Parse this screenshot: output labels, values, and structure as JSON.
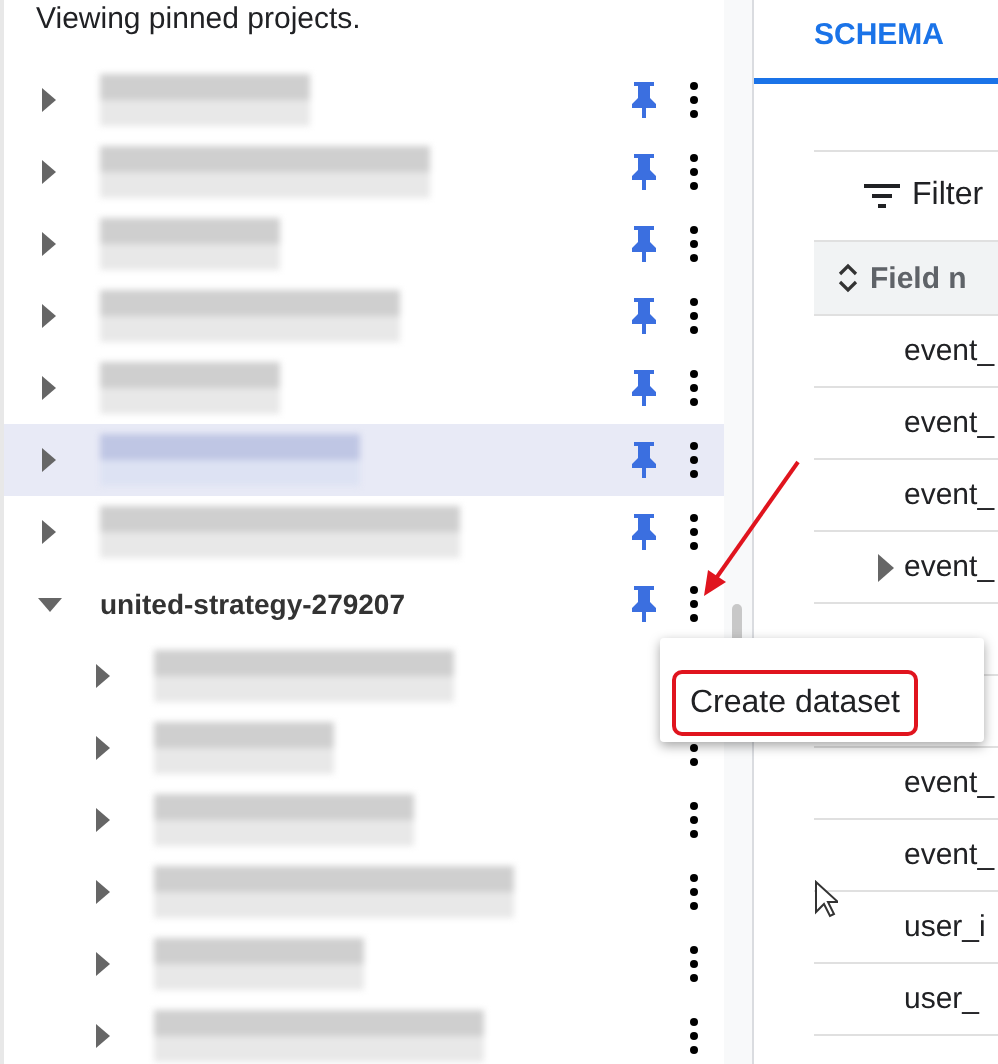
{
  "explorer": {
    "notice": "Viewing pinned projects.",
    "projects": [
      {
        "kind": "redacted",
        "pinned": true,
        "expanded": false,
        "selected": false
      },
      {
        "kind": "redacted",
        "pinned": true,
        "expanded": false,
        "selected": false
      },
      {
        "kind": "redacted",
        "pinned": true,
        "expanded": false,
        "selected": false
      },
      {
        "kind": "redacted",
        "pinned": true,
        "expanded": false,
        "selected": false
      },
      {
        "kind": "redacted",
        "pinned": true,
        "expanded": false,
        "selected": false
      },
      {
        "kind": "redacted",
        "pinned": true,
        "expanded": false,
        "selected": true
      },
      {
        "kind": "redacted",
        "pinned": true,
        "expanded": false,
        "selected": false
      },
      {
        "kind": "named",
        "name": "united-strategy-279207",
        "pinned": true,
        "expanded": true,
        "selected": false,
        "children": [
          {
            "kind": "redacted"
          },
          {
            "kind": "redacted"
          },
          {
            "kind": "redacted"
          },
          {
            "kind": "redacted"
          },
          {
            "kind": "redacted"
          },
          {
            "kind": "redacted"
          }
        ]
      }
    ]
  },
  "context_menu": {
    "items": [
      {
        "label": "Create dataset",
        "highlighted": true
      }
    ]
  },
  "schema_panel": {
    "tabs": [
      {
        "label": "SCHEMA",
        "selected": true
      }
    ],
    "filter": "Filter",
    "column": "Field n",
    "rows": [
      {
        "field": "event_",
        "expandable": false
      },
      {
        "field": "event_",
        "expandable": false
      },
      {
        "field": "event_",
        "expandable": false
      },
      {
        "field": "event_",
        "expandable": true
      },
      {
        "covered": true
      },
      {
        "covered": true
      },
      {
        "field": "event_",
        "expandable": false
      },
      {
        "field": "event_",
        "expandable": false
      },
      {
        "field": "user_i",
        "expandable": false
      },
      {
        "field": "user_",
        "expandable": false
      }
    ]
  }
}
